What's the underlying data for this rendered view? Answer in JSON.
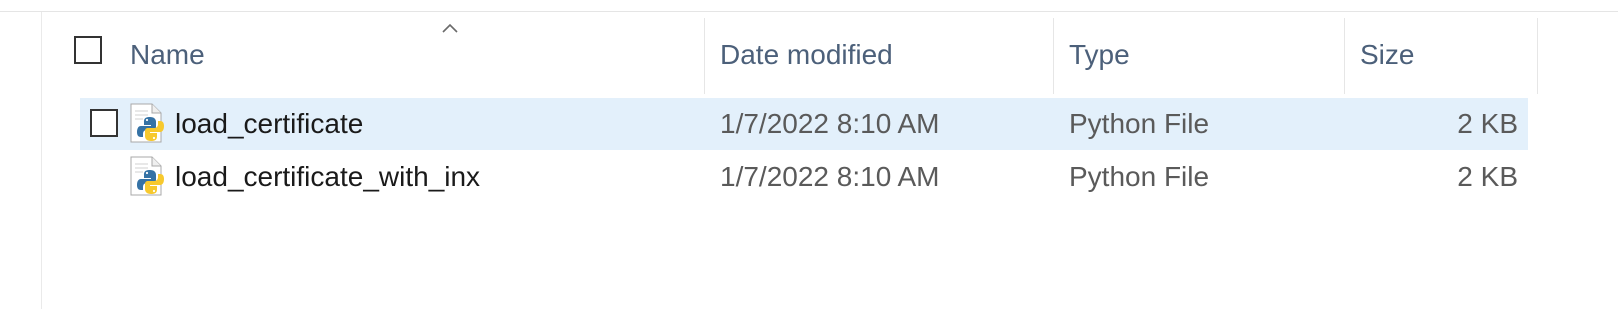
{
  "columns": {
    "name": "Name",
    "date_modified": "Date modified",
    "type": "Type",
    "size": "Size",
    "sort_indicator": "ascending"
  },
  "files": [
    {
      "name": "load_certificate",
      "date_modified": "1/7/2022 8:10 AM",
      "type": "Python File",
      "size": "2 KB",
      "icon": "python-file-icon",
      "hover": true
    },
    {
      "name": "load_certificate_with_inx",
      "date_modified": "1/7/2022 8:10 AM",
      "type": "Python File",
      "size": "2 KB",
      "icon": "python-file-icon",
      "hover": false
    }
  ],
  "colors": {
    "hover_row": "#e3f0fb",
    "header_text": "#4c607a",
    "python_blue": "#3572a5",
    "python_yellow": "#f7c92e"
  }
}
